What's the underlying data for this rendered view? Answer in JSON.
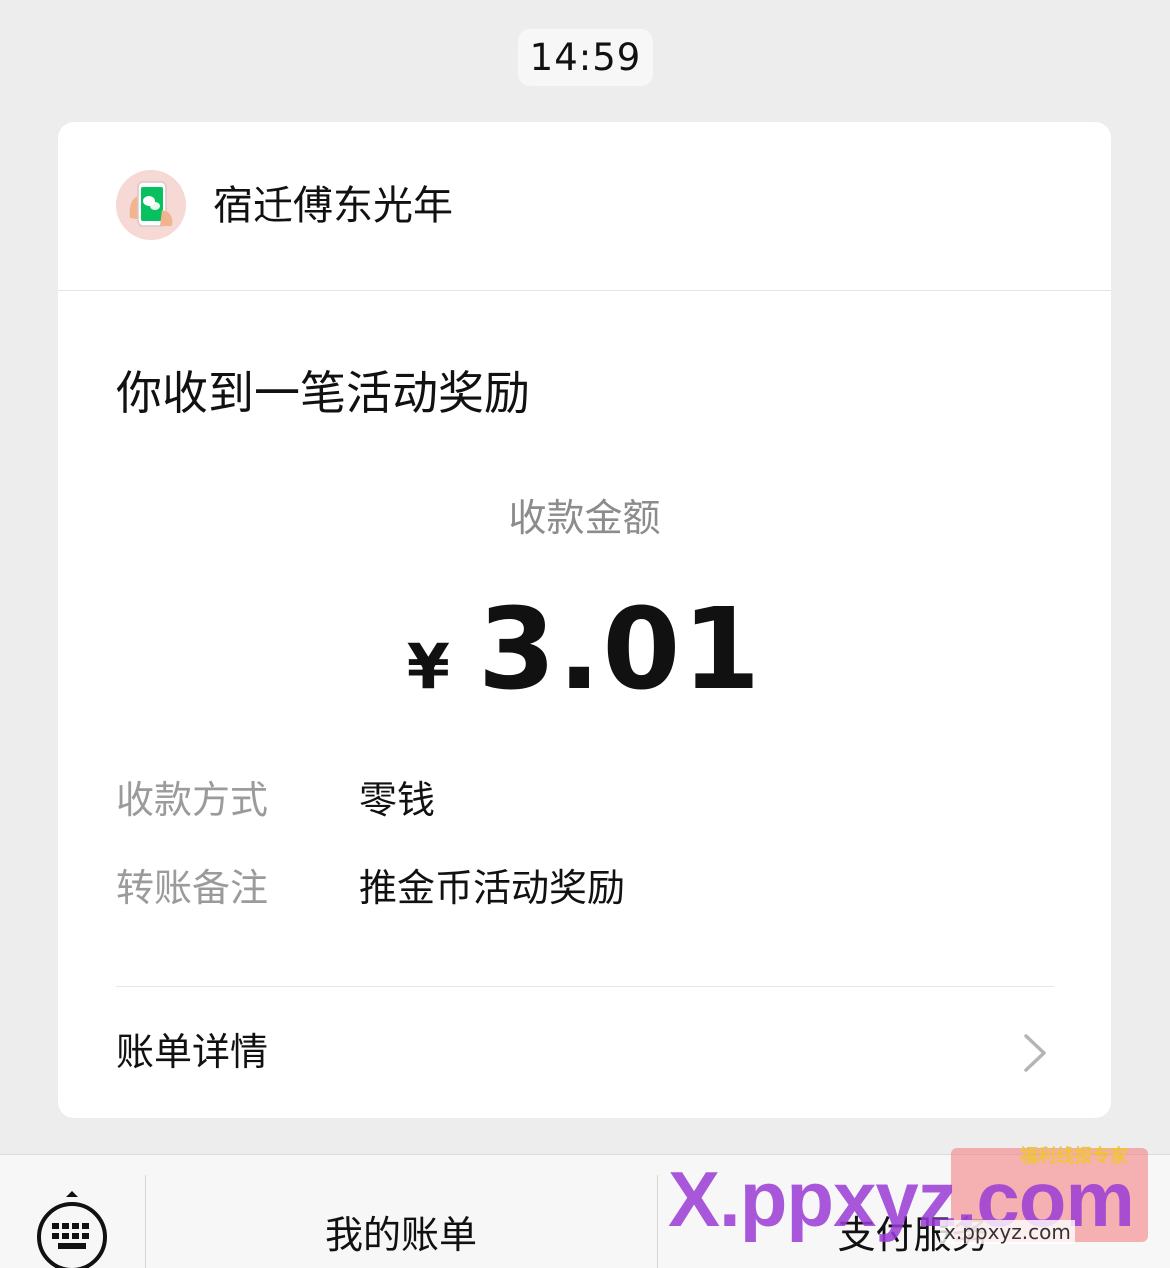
{
  "timestamp": "14:59",
  "card": {
    "merchant_name": "宿迁傅东光年",
    "title": "你收到一笔活动奖励",
    "amount_label": "收款金额",
    "currency_symbol": "¥",
    "amount": "3.01",
    "details": [
      {
        "label": "收款方式",
        "value": "零钱"
      },
      {
        "label": "转账备注",
        "value": "推金币活动奖励"
      }
    ],
    "bill_detail_label": "账单详情"
  },
  "bottom_bar": {
    "items": [
      {
        "label": "我的账单"
      },
      {
        "label": "支付服务"
      }
    ]
  },
  "watermark": {
    "main": "X.ppxyz.com",
    "badge_text": "福利线报专家",
    "url": "x.ppxyz.com"
  },
  "colors": {
    "background": "#ededed",
    "card": "#ffffff",
    "label_gray": "#9b9b9b",
    "text": "#111111",
    "wechat_green": "#07c160"
  },
  "icons": {
    "avatar": "wechat-pay-phone-icon",
    "chevron": "chevron-right-icon",
    "keyboard": "keyboard-icon"
  }
}
